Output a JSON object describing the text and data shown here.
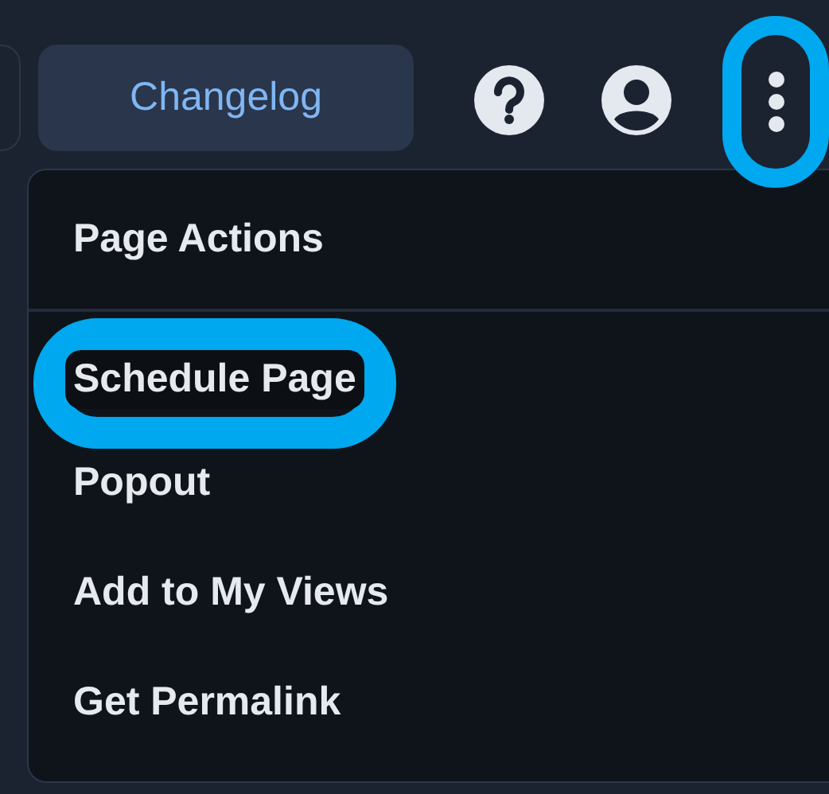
{
  "toolbar": {
    "changelog_button": "Changelog",
    "more_button": {
      "highlighted": true
    }
  },
  "menu": {
    "title": "Page Actions",
    "items": [
      {
        "label": "Schedule Page",
        "highlighted": true
      },
      {
        "label": "Popout",
        "highlighted": false
      },
      {
        "label": "Add to My Views",
        "highlighted": false
      },
      {
        "label": "Get Permalink",
        "highlighted": false
      }
    ]
  }
}
